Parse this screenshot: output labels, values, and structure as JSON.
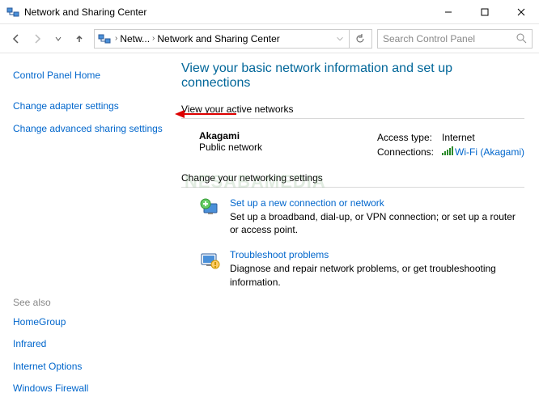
{
  "titlebar": {
    "title": "Network and Sharing Center"
  },
  "breadcrumb": {
    "c1": "Netw...",
    "c2": "Network and Sharing Center"
  },
  "search": {
    "placeholder": "Search Control Panel"
  },
  "sidebar": {
    "home": "Control Panel Home",
    "links": {
      "adapter": "Change adapter settings",
      "advanced": "Change advanced sharing settings"
    },
    "seealso": {
      "head": "See also",
      "homegroup": "HomeGroup",
      "infrared": "Infrared",
      "inetopt": "Internet Options",
      "firewall": "Windows Firewall"
    }
  },
  "main": {
    "title": "View your basic network information and set up connections",
    "sect_active": "View your active networks",
    "network": {
      "name": "Akagami",
      "type": "Public network",
      "access_label": "Access type:",
      "access_value": "Internet",
      "conn_label": "Connections:",
      "conn_value": "Wi-Fi (Akagami)"
    },
    "sect_change": "Change your networking settings",
    "opt1": {
      "title": "Set up a new connection or network",
      "desc": "Set up a broadband, dial-up, or VPN connection; or set up a router or access point."
    },
    "opt2": {
      "title": "Troubleshoot problems",
      "desc": "Diagnose and repair network problems, or get troubleshooting information."
    }
  },
  "watermark": "NESABAMEDIA"
}
